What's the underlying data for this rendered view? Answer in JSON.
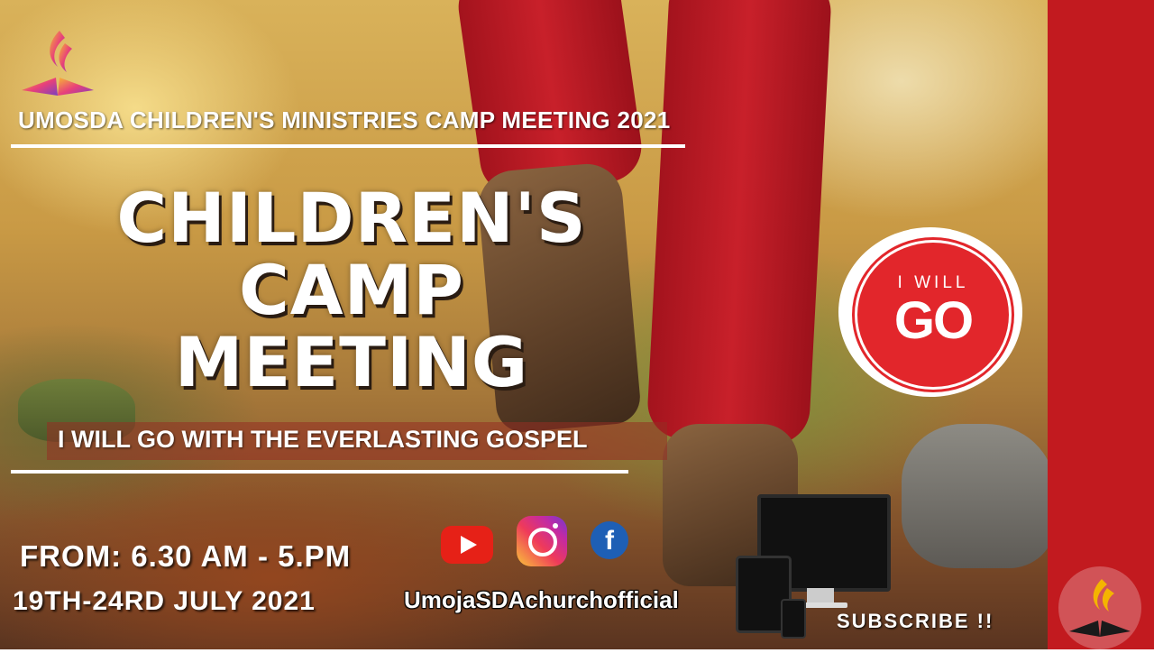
{
  "event": {
    "org_title": "UMOSDA CHILDREN'S MINISTRIES CAMP MEETING 2021",
    "headline_line1": "CHILDREN'S",
    "headline_line2": "CAMP",
    "headline_line3": "MEETING",
    "theme": "I WILL GO WITH THE EVERLASTING GOSPEL",
    "time": "FROM: 6.30 AM - 5.PM",
    "dates": "19TH-24RD JULY 2021"
  },
  "badge": {
    "top": "I WILL",
    "main": "GO"
  },
  "social": {
    "handle": "UmojaSDAchurchofficial",
    "subscribe": "SUBSCRIBE !!",
    "icons": [
      "youtube-icon",
      "instagram-icon",
      "facebook-icon"
    ],
    "facebook_glyph": "f"
  },
  "colors": {
    "brand_red": "#c21a1f",
    "badge_red": "#e2262b",
    "text": "#ffffff"
  }
}
